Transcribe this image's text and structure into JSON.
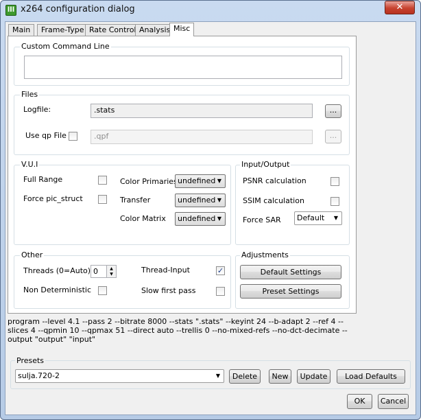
{
  "window": {
    "title": "x264 configuration dialog",
    "icon_glyph": "lll",
    "close_glyph": "✕"
  },
  "tabs": [
    {
      "label": "Main"
    },
    {
      "label": "Frame-Type"
    },
    {
      "label": "Rate Control"
    },
    {
      "label": "Analysis"
    },
    {
      "label": "Misc",
      "active": true
    }
  ],
  "custom_command_line": {
    "group_label": "Custom Command Line",
    "value": ""
  },
  "files": {
    "group_label": "Files",
    "logfile_label": "Logfile:",
    "logfile_value": ".stats",
    "logfile_browse": "...",
    "use_qp_label": "Use qp File",
    "use_qp_checked": false,
    "qp_value": ".qpf",
    "qp_browse": "..."
  },
  "vui": {
    "group_label": "V.U.I",
    "full_range_label": "Full Range",
    "full_range_checked": false,
    "force_pic_label": "Force pic_struct",
    "force_pic_checked": false,
    "color_primaries_label": "Color Primaries",
    "color_primaries_value": "undefined",
    "transfer_label": "Transfer",
    "transfer_value": "undefined",
    "color_matrix_label": "Color Matrix",
    "color_matrix_value": "undefined"
  },
  "io": {
    "group_label": "Input/Output",
    "psnr_label": "PSNR calculation",
    "psnr_checked": false,
    "ssim_label": "SSIM calculation",
    "ssim_checked": false,
    "force_sar_label": "Force SAR",
    "force_sar_value": "Default"
  },
  "other": {
    "group_label": "Other",
    "threads_label": "Threads (0=Auto)",
    "threads_value": "0",
    "thread_input_label": "Thread-Input",
    "thread_input_checked": true,
    "non_det_label": "Non Deterministic",
    "non_det_checked": false,
    "slow_first_label": "Slow first pass",
    "slow_first_checked": false
  },
  "adjustments": {
    "group_label": "Adjustments",
    "default_settings": "Default Settings",
    "preset_settings": "Preset Settings"
  },
  "command_line_output": "program --level 4.1 --pass 2 --bitrate 8000 --stats \".stats\" --keyint 24 --b-adapt 2 --ref 4 --slices 4 --qpmin 10 --qpmax 51 --direct auto --trellis 0 --no-mixed-refs --no-dct-decimate --output \"output\" \"input\"",
  "presets": {
    "group_label": "Presets",
    "selected": "sulja.720-2",
    "delete": "Delete",
    "new": "New",
    "update": "Update",
    "load_defaults": "Load Defaults"
  },
  "dialog": {
    "ok": "OK",
    "cancel": "Cancel"
  },
  "icons": {
    "check": "✓",
    "dropdown": "▼",
    "spin_up": "▲",
    "spin_down": "▼"
  }
}
